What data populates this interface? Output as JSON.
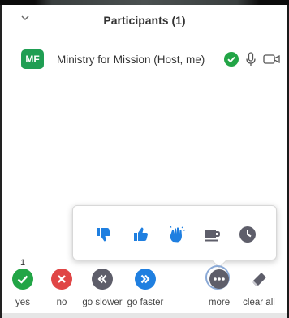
{
  "panel": {
    "title": "Participants (1)",
    "collapse_icon": "chevron-down-icon"
  },
  "participant": {
    "initials": "MF",
    "avatar_color": "#1f9e53",
    "name": "Ministry for Mission (Host, me)",
    "status_icon": "check-circle-icon",
    "mic_icon": "microphone-icon",
    "camera_icon": "video-camera-icon"
  },
  "reactions": [
    {
      "name": "thumbs-down-icon"
    },
    {
      "name": "thumbs-up-icon"
    },
    {
      "name": "clapping-hands-icon"
    },
    {
      "name": "coffee-cup-icon"
    },
    {
      "name": "clock-icon"
    }
  ],
  "feedback": {
    "yes_count": "1",
    "buttons": [
      {
        "label": "yes",
        "color": "#22a546"
      },
      {
        "label": "no",
        "color": "#e04646"
      },
      {
        "label": "go slower",
        "color": "#5e5e6a"
      },
      {
        "label": "go faster",
        "color": "#1f7fe0"
      },
      {
        "label": "more",
        "color": "#5e5e6a"
      },
      {
        "label": "clear all",
        "color": "#5e5e6a"
      }
    ]
  },
  "colors": {
    "accent_blue": "#1f7fe0",
    "text": "#333333"
  }
}
